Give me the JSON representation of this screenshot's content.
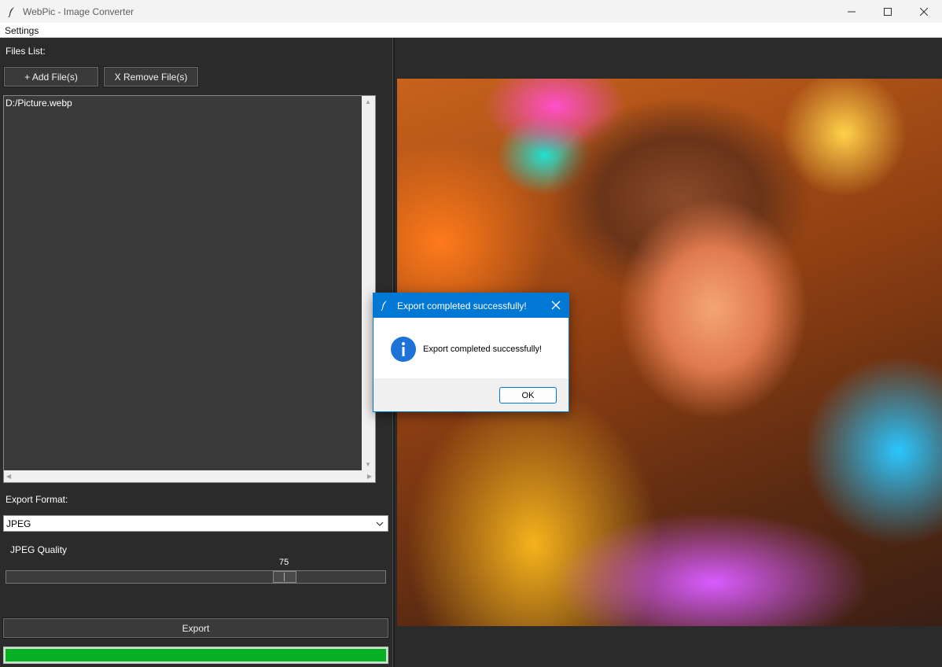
{
  "window": {
    "title": "WebPic - Image Converter"
  },
  "menubar": {
    "settings_label": "Settings"
  },
  "left_panel": {
    "files_list_label": "Files List:",
    "add_files_label": "+ Add File(s)",
    "remove_files_label": "X Remove File(s)",
    "files": [
      "D:/Picture.webp"
    ],
    "export_format_label": "Export Format:",
    "export_format_value": "JPEG",
    "quality_label": "JPEG Quality",
    "quality_value": "75",
    "quality_fraction": 0.75,
    "export_label": "Export",
    "progress": 1.0
  },
  "preview": {
    "description_icon": "image-preview"
  },
  "dialog": {
    "title": "Export completed successfully!",
    "message": "Export completed successfully!",
    "ok_label": "OK",
    "icon": "info-icon"
  },
  "colors": {
    "accent": "#0078d4",
    "progress": "#06b025",
    "panel_bg": "#2b2b2b"
  }
}
